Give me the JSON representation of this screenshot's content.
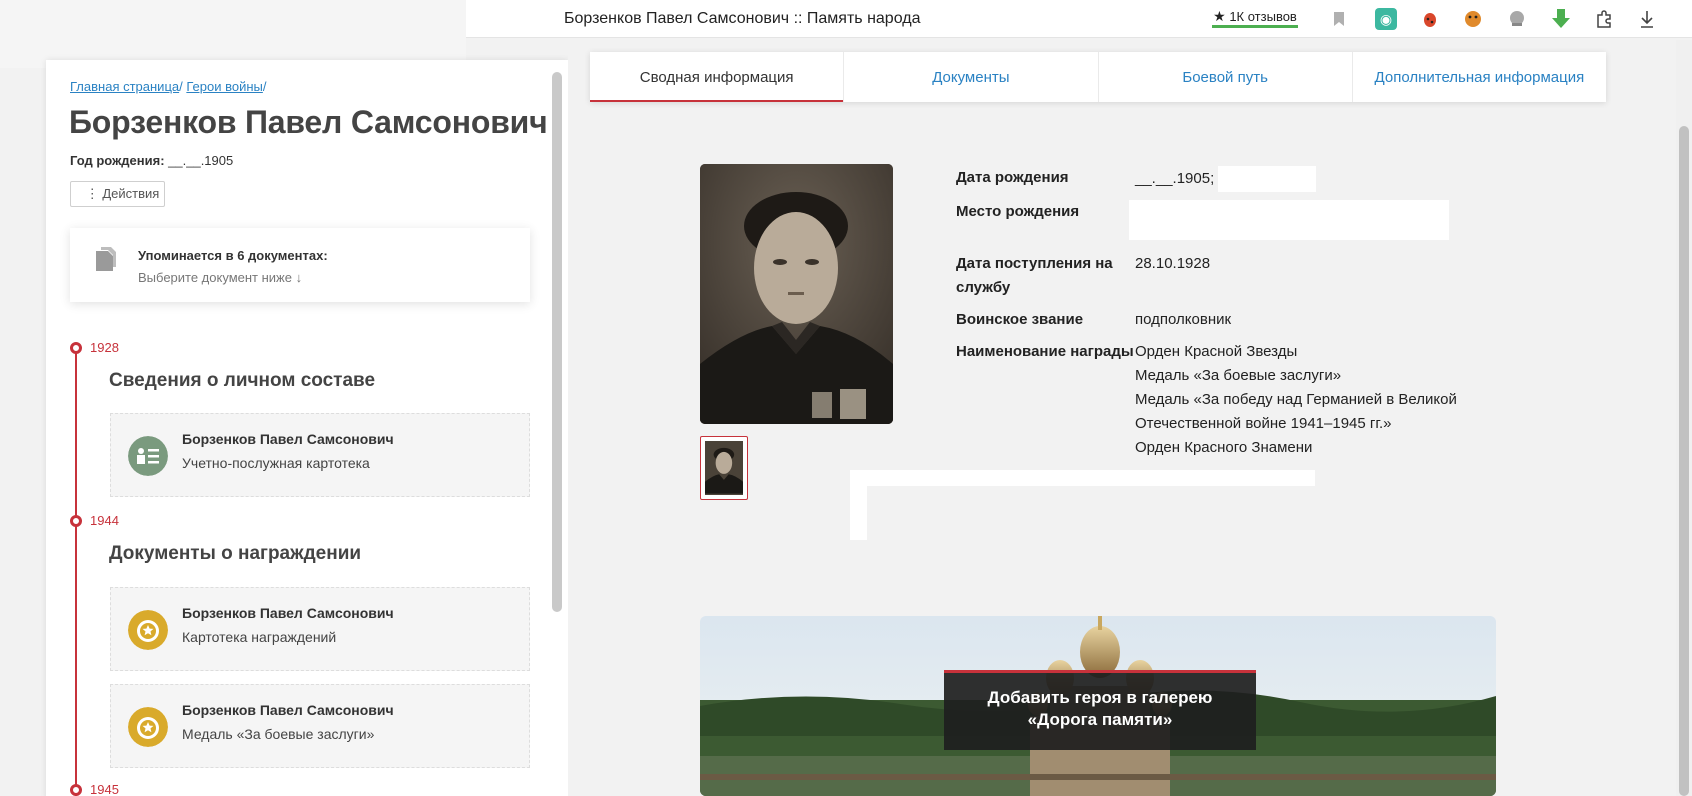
{
  "browser": {
    "page_title": "Борзенков Павел Самсонович :: Память народа",
    "reviews_label": "1К отзывов",
    "toolbar_icons": [
      "bookmark-icon",
      "extension-icon",
      "bug-icon",
      "face-icon",
      "helmet-icon",
      "download-arrow-icon",
      "puzzle-icon",
      "download-icon"
    ]
  },
  "left": {
    "breadcrumb": [
      {
        "label": "Главная страница"
      },
      {
        "label": "Герои войны"
      }
    ],
    "hero_name": "Борзенков Павел Самсонович",
    "birth_label": "Год рождения:",
    "birth_value": "__.__.1905",
    "actions_label": "⋮  Действия",
    "mentions_title": "Упоминается в 6 документах:",
    "mentions_sub": "Выберите документ ниже  ↓",
    "timeline": [
      {
        "year": "1928",
        "section": "Сведения о личном составе",
        "docs": [
          {
            "name": "Борзенков Павел Самсонович",
            "type": "Учетно-послужная картотека",
            "icon": "personnel-card-icon"
          }
        ]
      },
      {
        "year": "1944",
        "section": "Документы о награждении",
        "docs": [
          {
            "name": "Борзенков Павел Самсонович",
            "type": "Картотека награждений",
            "icon": "medal-icon"
          },
          {
            "name": "Борзенков Павел Самсонович",
            "type": "Медаль «За боевые заслуги»",
            "icon": "medal-icon"
          }
        ]
      },
      {
        "year": "1945"
      }
    ]
  },
  "tabs": [
    {
      "label": "Сводная информация",
      "active": true
    },
    {
      "label": "Документы",
      "active": false
    },
    {
      "label": "Боевой путь",
      "active": false
    },
    {
      "label": "Дополнительная информация",
      "active": false
    }
  ],
  "info": {
    "birth_date_label": "Дата рождения",
    "birth_date_value": "__.__.1905;",
    "birth_place_label": "Место рождения",
    "service_date_label": "Дата поступления на службу",
    "service_date_value": "28.10.1928",
    "rank_label": "Воинское звание",
    "rank_value": "подполковник",
    "award_label": "Наименование награды",
    "awards": [
      "Орден Красной Звезды",
      "Медаль «За боевые заслуги»",
      "Медаль «За победу над Германией в Великой Отечественной войне 1941–1945 гг.»",
      "Орден Красного Знамени"
    ]
  },
  "gallery": {
    "button_line1": "Добавить героя в галерею",
    "button_line2": "«Дорога памяти»"
  },
  "colors": {
    "accent_red": "#c7323b",
    "link_blue": "#2a82c3",
    "icon_green": "#7a9a7e",
    "icon_gold": "#d9aa2b"
  }
}
